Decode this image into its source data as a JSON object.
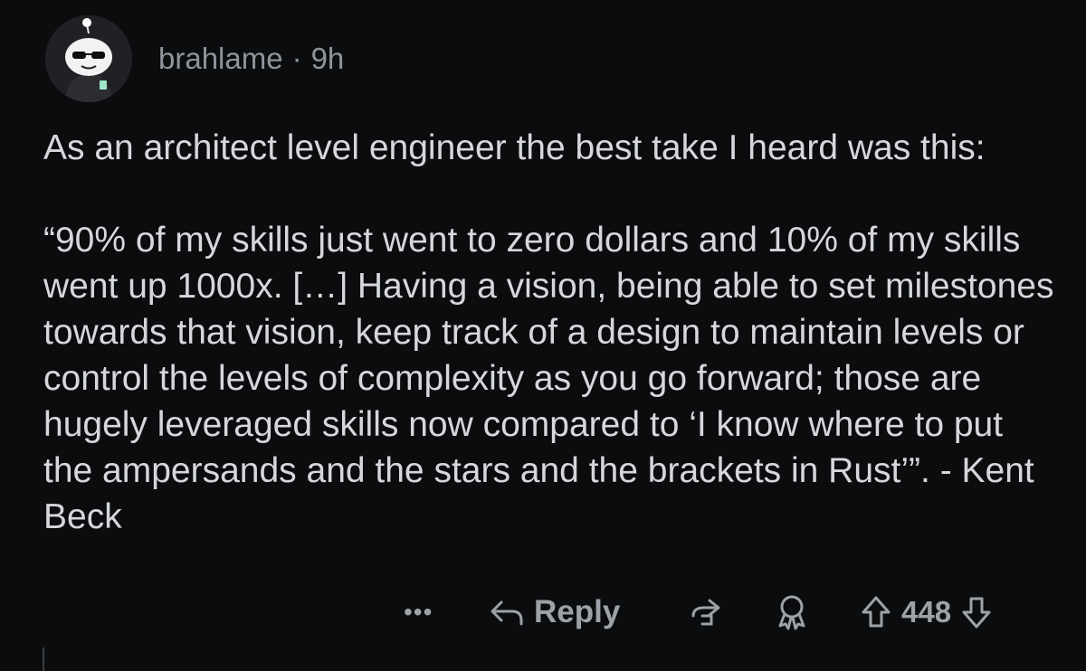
{
  "author": {
    "username": "brahlame",
    "separator": "·",
    "age": "9h",
    "avatar_icon": "snoo-avatar-icon"
  },
  "body": {
    "paragraphs": [
      "As an architect level engineer the best take I heard was this:",
      "“90% of my skills just went to zero dollars and 10% of my skills went up 1000x. […] Having a vision, being able to set milestones towards that vision, keep track of a design to maintain levels or control the levels of complexity as you go forward; those are hugely leveraged skills now compared to ‘I know where to put the ampersands and the stars and the brackets in Rust’”. - Kent Beck"
    ]
  },
  "actions": {
    "more_label": "•••",
    "reply_label": "Reply",
    "share_icon": "share-icon",
    "award_icon": "award-icon",
    "upvote_icon": "upvote-arrow-icon",
    "vote_count": "448",
    "downvote_icon": "downvote-arrow-icon"
  },
  "colors": {
    "background": "#0b0c0e",
    "text": "#d5d7da",
    "muted": "#8f949b"
  }
}
